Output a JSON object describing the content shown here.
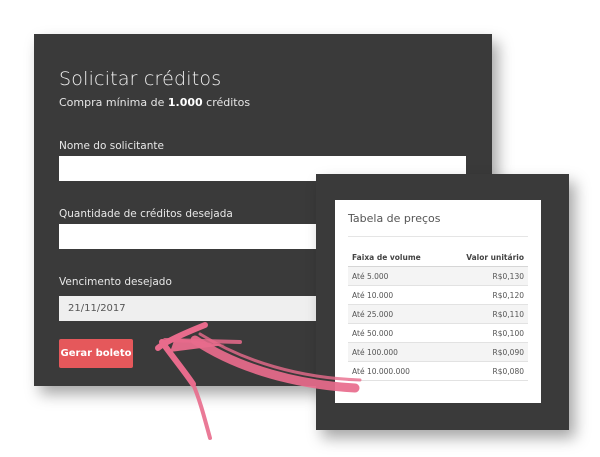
{
  "form": {
    "title": "Solicitar créditos",
    "subtitle_prefix": "Compra mínima de ",
    "subtitle_bold": "1.000",
    "subtitle_suffix": " créditos",
    "name_label": "Nome do solicitante",
    "name_value": "",
    "quantity_label": "Quantidade de créditos desejada",
    "quantity_value": "",
    "due_label": "Vencimento desejado",
    "due_value": "21/11/2017",
    "submit_label": "Gerar boleto"
  },
  "prices": {
    "title": "Tabela de preços",
    "headers": [
      "Faixa de volume",
      "Valor unitário"
    ],
    "rows": [
      [
        "Até 5.000",
        "R$0,130"
      ],
      [
        "Até 10.000",
        "R$0,120"
      ],
      [
        "Até 25.000",
        "R$0,110"
      ],
      [
        "Até 50.000",
        "R$0,100"
      ],
      [
        "Até 100.000",
        "R$0,090"
      ],
      [
        "Até 10.000.000",
        "R$0,080"
      ]
    ]
  },
  "colors": {
    "panel": "#3a3a3a",
    "accent": "#e5585b",
    "arrow": "#e86b8c"
  }
}
